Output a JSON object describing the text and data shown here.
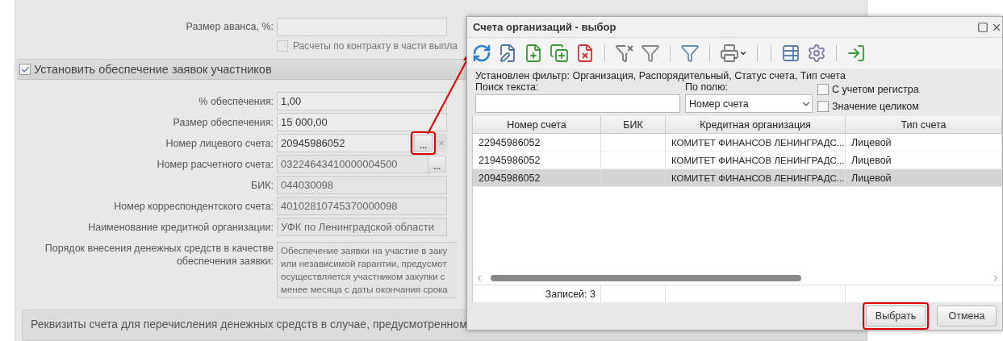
{
  "form": {
    "advance": {
      "label": "Размер аванса, %:"
    },
    "advance_option": {
      "label": "Расчеты по контракту в части выпла",
      "checked": false,
      "disabled": true
    },
    "section": {
      "label": "Установить обеспечение заявок участников",
      "checked": true
    },
    "fields": [
      {
        "label": "% обеспечения:",
        "value": "1,00",
        "kind": "text",
        "disabled": false
      },
      {
        "label": "Размер обеспечения:",
        "value": "15 000,00",
        "kind": "text",
        "disabled": false
      },
      {
        "label": "Номер лицевого счета:",
        "value": "20945986052",
        "kind": "picker_clear",
        "disabled": false,
        "highlighted": true,
        "browse_label": "...",
        "clear_symbol": "×"
      },
      {
        "label": "Номер расчетного счета:",
        "value": "03224643410000004500",
        "kind": "picker",
        "disabled": true,
        "highlighted": false,
        "browse_label": "..."
      },
      {
        "label": "БИК:",
        "value": "044030098",
        "kind": "text",
        "disabled": true
      },
      {
        "label": "Номер корреспондентского счета:",
        "value": "40102810745370000098",
        "kind": "text",
        "disabled": true
      },
      {
        "label": "Наименование кредитной организации:",
        "value": "УФК по Ленинградской области",
        "kind": "text",
        "disabled": true
      }
    ],
    "order": {
      "label": "Порядок внесения денежных средств в качестве обеспечения заявки:",
      "lines": [
        "Обеспечение заявки на участие в заку",
        "или независимой гарантии, предусмот",
        "осуществляется участником закупки с",
        "менее месяца с даты окончания срока"
      ]
    },
    "bottom_panel": {
      "text": "Реквизиты счета для перечисления денежных средств в случае, предусмотренном"
    }
  },
  "dialog": {
    "title": "Счета организаций - выбор",
    "filter_text": "Установлен фильтр: Организация, Распорядительный, Статус счета, Тип счета",
    "search": {
      "label": "Поиск текста:"
    },
    "field_select": {
      "label": "По полю:",
      "value": "Номер счета"
    },
    "options": [
      {
        "label": "С учетом регистра",
        "checked": false
      },
      {
        "label": "Значение целиком",
        "checked": false
      }
    ],
    "table": {
      "columns": [
        "Номер счета",
        "БИК",
        "Кредитная организация",
        "Тип счета"
      ],
      "rows": [
        {
          "cells": [
            "22945986052",
            "",
            "КОМИТЕТ ФИНАНСОВ ЛЕНИНГРАДС...",
            "Лицевой"
          ],
          "selected": false
        },
        {
          "cells": [
            "21945986052",
            "",
            "КОМИТЕТ ФИНАНСОВ ЛЕНИНГРАДС...",
            "Лицевой"
          ],
          "selected": false
        },
        {
          "cells": [
            "20945986052",
            "",
            "КОМИТЕТ ФИНАНСОВ ЛЕНИНГРАДС...",
            "Лицевой"
          ],
          "selected": true
        }
      ],
      "footer": "Записей: 3"
    },
    "buttons": [
      {
        "label": "Выбрать",
        "highlighted": true
      },
      {
        "label": "Отмена",
        "highlighted": false
      }
    ]
  }
}
